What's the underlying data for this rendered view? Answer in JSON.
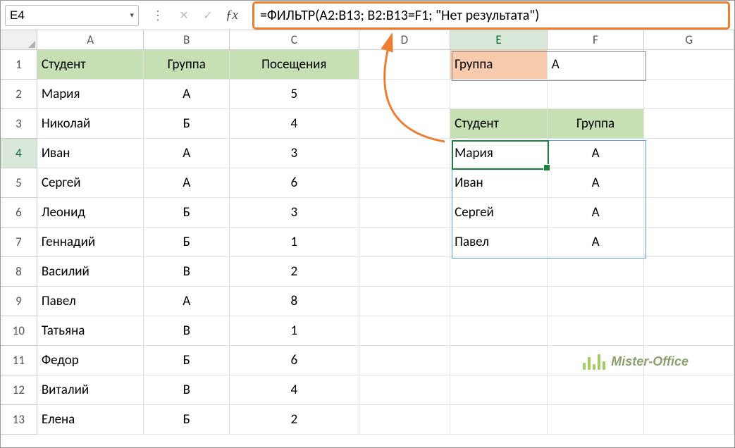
{
  "name_box": "E4",
  "formula": "=ФИЛЬТР(A2:B13; B2:B13=F1; \"Нет результата\")",
  "columns": [
    "A",
    "B",
    "C",
    "D",
    "E",
    "F",
    "G"
  ],
  "data": {
    "headers": {
      "A1": "Студент",
      "B1": "Группа",
      "C1": "Посещения"
    },
    "rows": [
      {
        "name": "Мария",
        "grp": "А",
        "vis": "5"
      },
      {
        "name": "Николай",
        "grp": "Б",
        "vis": "4"
      },
      {
        "name": "Иван",
        "grp": "А",
        "vis": "3"
      },
      {
        "name": "Сергей",
        "grp": "А",
        "vis": "6"
      },
      {
        "name": "Леонид",
        "grp": "Б",
        "vis": "3"
      },
      {
        "name": "Геннадий",
        "grp": "Б",
        "vis": "1"
      },
      {
        "name": "Василий",
        "grp": "В",
        "vis": "2"
      },
      {
        "name": "Павел",
        "grp": "А",
        "vis": "8"
      },
      {
        "name": "Татьяна",
        "grp": "В",
        "vis": "1"
      },
      {
        "name": "Федор",
        "grp": "Б",
        "vis": "6"
      },
      {
        "name": "Виталий",
        "grp": "В",
        "vis": "4"
      },
      {
        "name": "Елена",
        "grp": "Б",
        "vis": "2"
      }
    ],
    "filter_label": "Группа",
    "filter_value": "А",
    "filter_hdr_e": "Студент",
    "filter_hdr_f": "Группа",
    "filtered": [
      {
        "name": "Мария",
        "grp": "А"
      },
      {
        "name": "Иван",
        "grp": "А"
      },
      {
        "name": "Сергей",
        "grp": "А"
      },
      {
        "name": "Павел",
        "grp": "А"
      }
    ]
  },
  "watermark": "Mister-Office"
}
